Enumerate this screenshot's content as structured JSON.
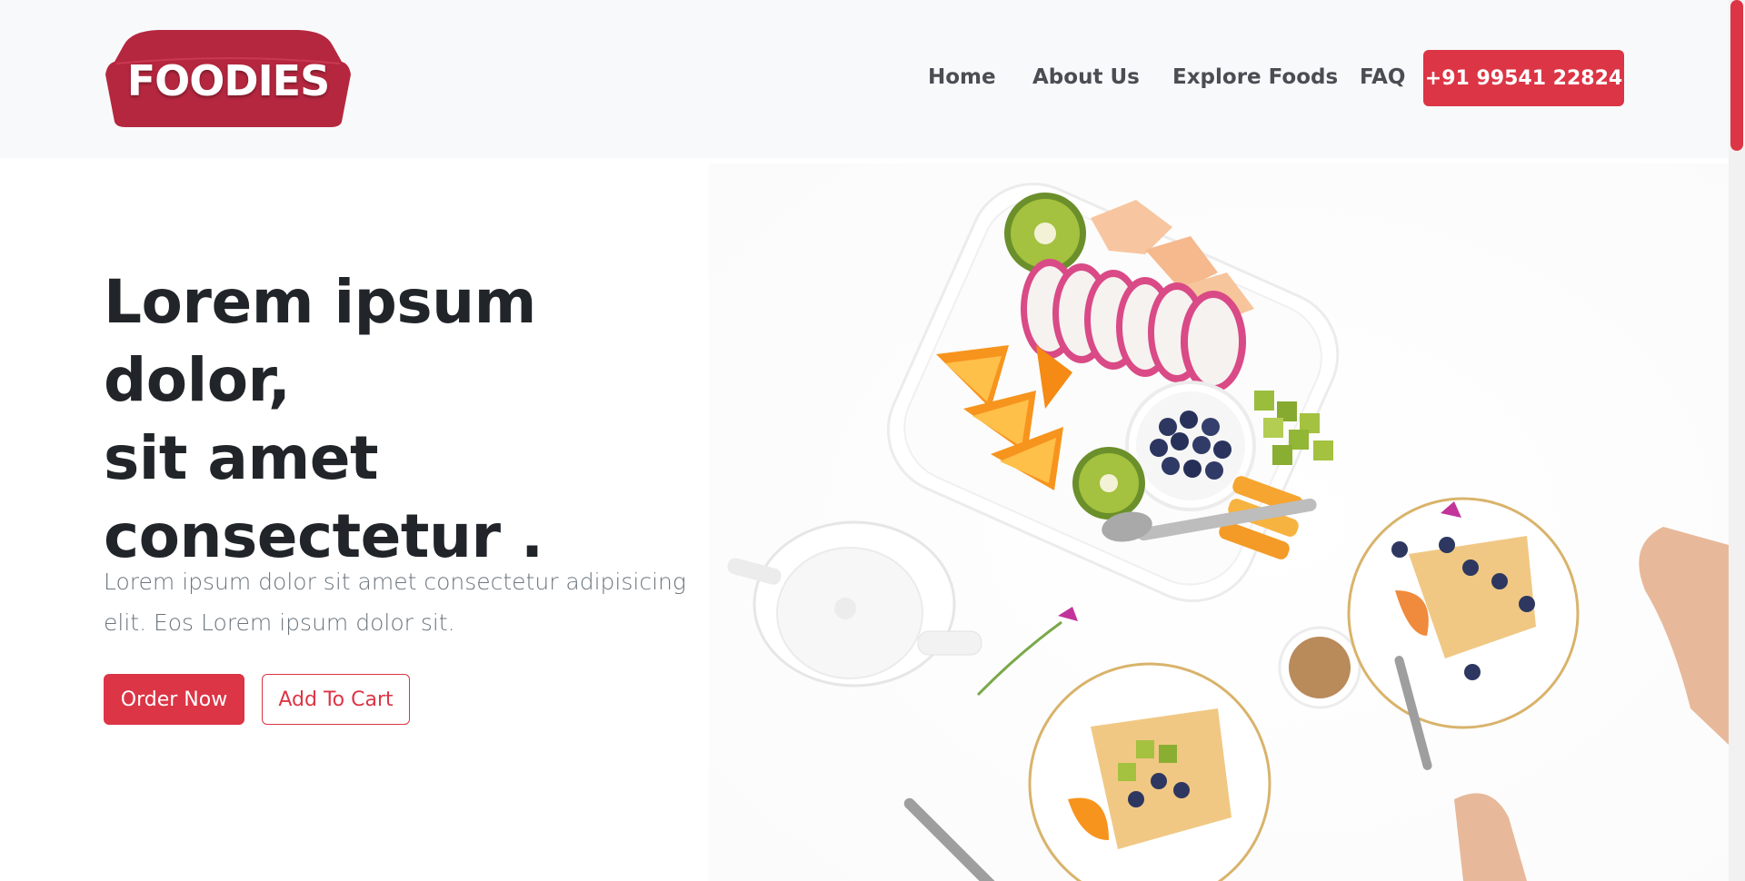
{
  "header": {
    "logo_text": "FOODIES",
    "nav": {
      "home": "Home",
      "about": "About Us",
      "explore": "Explore Foods",
      "faq": "FAQ"
    },
    "phone_label": "+91 99541 22824"
  },
  "hero": {
    "title_line1": "Lorem ipsum dolor,",
    "title_line2": "sit amet",
    "title_line3": "consectetur .",
    "subtitle_line1": "Lorem ipsum dolor sit amet consectetur adipisicing",
    "subtitle_line2": "elit. Eos Lorem ipsum dolor sit.",
    "order_label": "Order Now",
    "cart_label": "Add To Cart"
  },
  "colors": {
    "brand": "#dc3545",
    "logo_bg": "#b5273f",
    "header_bg": "#f8f9fa",
    "title": "#212529",
    "muted": "#6c757d"
  }
}
